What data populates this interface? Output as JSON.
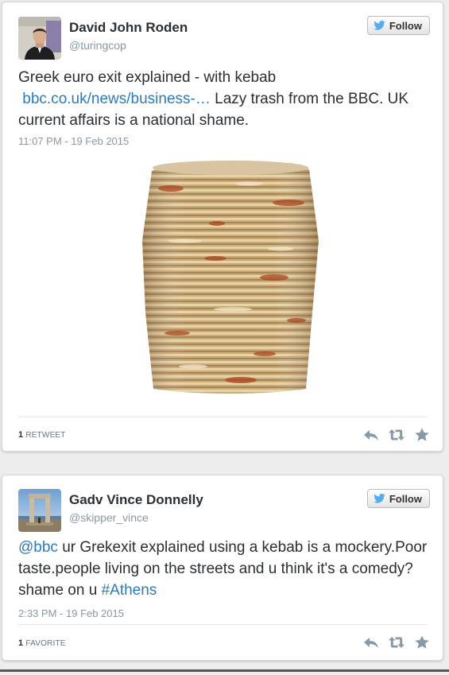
{
  "colors": {
    "link": "#2b7bb9",
    "text": "#292f33",
    "muted": "#8899a6",
    "twitter_blue": "#55acee",
    "action_icon": "#8899a6"
  },
  "tweets": [
    {
      "author": {
        "name": "David John Roden",
        "handle": "@turingcop",
        "avatar_icon": "profile-photo-man-in-suit"
      },
      "follow_label": "Follow",
      "text": {
        "part1": "Greek euro exit explained - with kebab",
        "link": "bbc.co.uk/news/business-…",
        "part2": " Lazy trash from the BBC. UK current affairs is a national shame."
      },
      "timestamp": "11:07 PM - 19 Feb 2015",
      "media_icon": "kebab-meat-stack-photo",
      "stat": {
        "count": "1",
        "label": "Retweet"
      },
      "actions": [
        "reply-icon",
        "retweet-icon",
        "favorite-icon"
      ]
    },
    {
      "author": {
        "name": "Gadv Vince Donnelly",
        "handle": "@skipper_vince",
        "avatar_icon": "profile-photo-ancient-gateway"
      },
      "follow_label": "Follow",
      "text": {
        "mention": "@bbc",
        "part1": " ur Grekexit explained using a kebab is a mockery.Poor taste.people living on the streets and u think it's a comedy? shame on u ",
        "hashtag": "#Athens"
      },
      "timestamp": "2:33 PM - 19 Feb 2015",
      "stat": {
        "count": "1",
        "label": "Favorite"
      },
      "actions": [
        "reply-icon",
        "retweet-icon",
        "favorite-icon"
      ]
    }
  ]
}
